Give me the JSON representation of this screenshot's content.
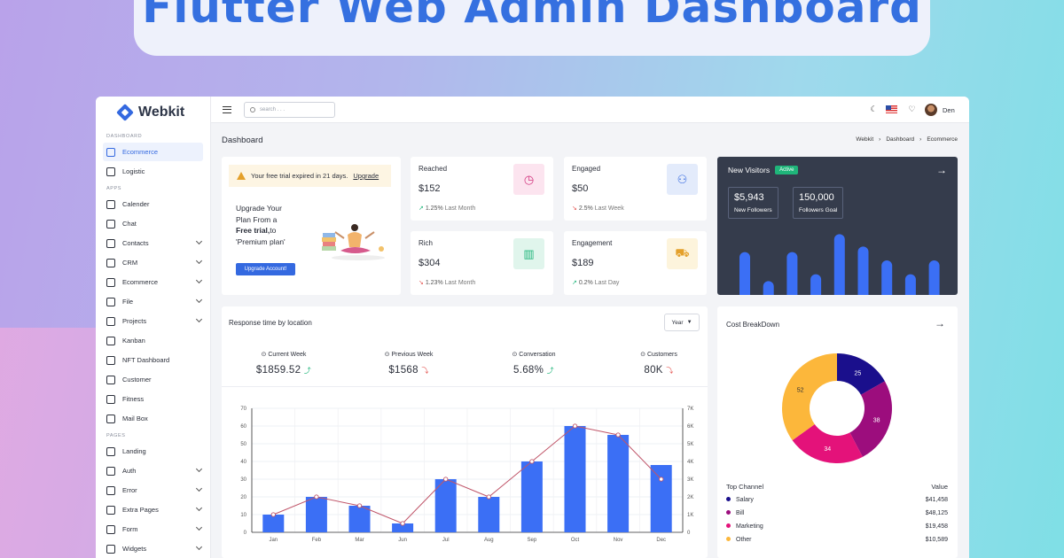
{
  "banner": {
    "title": "Flutter Web Admin Dashboard"
  },
  "brand": {
    "name": "Webkit"
  },
  "sidebar": {
    "sections": [
      {
        "label": "DASHBOARD",
        "items": [
          {
            "label": "Ecommerce",
            "active": true,
            "chevron": false
          },
          {
            "label": "Logistic",
            "chevron": false
          }
        ]
      },
      {
        "label": "APPS",
        "items": [
          {
            "label": "Calender",
            "chevron": false
          },
          {
            "label": "Chat",
            "chevron": false
          },
          {
            "label": "Contacts",
            "chevron": true
          },
          {
            "label": "CRM",
            "chevron": true
          },
          {
            "label": "Ecommerce",
            "chevron": true
          },
          {
            "label": "File",
            "chevron": true
          },
          {
            "label": "Projects",
            "chevron": true
          },
          {
            "label": "Kanban",
            "chevron": false
          },
          {
            "label": "NFT Dashboard",
            "chevron": false
          },
          {
            "label": "Customer",
            "chevron": false
          },
          {
            "label": "Fitness",
            "chevron": false
          },
          {
            "label": "Mail Box",
            "chevron": false
          }
        ]
      },
      {
        "label": "PAGES",
        "items": [
          {
            "label": "Landing",
            "chevron": false
          },
          {
            "label": "Auth",
            "chevron": true
          },
          {
            "label": "Error",
            "chevron": true
          },
          {
            "label": "Extra Pages",
            "chevron": true
          },
          {
            "label": "Form",
            "chevron": true
          },
          {
            "label": "Widgets",
            "chevron": true
          }
        ]
      }
    ]
  },
  "topbar": {
    "search_placeholder": "search . . .",
    "user_name": "Den",
    "icons": [
      "menu-icon",
      "moon-icon",
      "us-flag-icon",
      "bell-icon"
    ]
  },
  "page": {
    "title": "Dashboard",
    "breadcrumb": [
      "Webkit",
      "Dashboard",
      "Ecommerce"
    ]
  },
  "trial": {
    "message": "Your free trial expired in 21 days.",
    "link": "Upgrade",
    "line1": "Upgrade Your",
    "line2": "Plan From a",
    "line3_bold": "Free trial,",
    "line3_rest": "to",
    "line4": "'Premium plan'",
    "button": "Upgrade Account!"
  },
  "stats": [
    {
      "title": "Reached",
      "value": "$152",
      "change": "1.25%",
      "period": "Last Month",
      "trend": "up",
      "icon": "clock-icon",
      "bg": "#fce4ef",
      "fg": "#d3357f"
    },
    {
      "title": "Engaged",
      "value": "$50",
      "change": "2.5%",
      "period": "Last Week",
      "trend": "down",
      "icon": "network-icon",
      "bg": "#e3ebfb",
      "fg": "#3469e0"
    },
    {
      "title": "Rich",
      "value": "$304",
      "change": "1.23%",
      "period": "Last Month",
      "trend": "down",
      "icon": "chart-icon",
      "bg": "#e0f5ec",
      "fg": "#1fb57a"
    },
    {
      "title": "Engagement",
      "value": "$189",
      "change": "0.2%",
      "period": "Last Day",
      "trend": "up",
      "icon": "cart-icon",
      "bg": "#fdf4dc",
      "fg": "#e4a02a"
    }
  ],
  "visitors": {
    "title": "New Visitors",
    "badge": "Active",
    "followers": "$5,943",
    "followers_label": "New Followers",
    "goal": "150,000",
    "goal_label": "Followers Goal",
    "bars": [
      0.62,
      0.2,
      0.62,
      0.3,
      0.88,
      0.7,
      0.5,
      0.3,
      0.5
    ]
  },
  "response": {
    "title": "Response time by location",
    "dropdown": "Year",
    "kpis": [
      {
        "label": "Current Week",
        "value": "$1859.52",
        "trend": "up"
      },
      {
        "label": "Previous Week",
        "value": "$1568",
        "trend": "down"
      },
      {
        "label": "Conversation",
        "value": "5.68%",
        "trend": "up"
      },
      {
        "label": "Customers",
        "value": "80K",
        "trend": "down"
      }
    ]
  },
  "chart_data": {
    "type": "bar",
    "categories": [
      "Jan",
      "Feb",
      "Mar",
      "Jun",
      "Jul",
      "Aug",
      "Sep",
      "Oct",
      "Nov",
      "Dec"
    ],
    "series": [
      {
        "type": "bar",
        "values": [
          10,
          20,
          15,
          5,
          30,
          20,
          40,
          60,
          55,
          38
        ],
        "color": "#3b6ff5"
      },
      {
        "type": "line",
        "axis": "right",
        "values": [
          1000,
          2000,
          1500,
          500,
          3000,
          2000,
          4000,
          6000,
          5500,
          3000
        ],
        "color": "#c0566a"
      }
    ],
    "y_ticks": [
      "0",
      "10",
      "20",
      "30",
      "40",
      "50",
      "60",
      "70"
    ],
    "y2_ticks": [
      "0",
      "1K",
      "2K",
      "3K",
      "4K",
      "5K",
      "6K",
      "7K"
    ],
    "ylim": [
      0,
      70
    ],
    "y2lim": [
      0,
      7000
    ],
    "grid": true
  },
  "cost": {
    "title": "Cost BreakDown",
    "donut": {
      "type": "pie",
      "labels": [
        "25",
        "38",
        "34",
        "52"
      ],
      "values": [
        25,
        38,
        34,
        52
      ],
      "colors": [
        "#1a0f8c",
        "#9c0d7d",
        "#e4127a",
        "#fcb73b"
      ]
    },
    "table_header": [
      "Top Channel",
      "Value"
    ],
    "rows": [
      {
        "name": "Salary",
        "value": "$41,458",
        "color": "#1a0f8c"
      },
      {
        "name": "Bill",
        "value": "$48,125",
        "color": "#9c0d7d"
      },
      {
        "name": "Marketing",
        "value": "$19,458",
        "color": "#e4127a"
      },
      {
        "name": "Other",
        "value": "$10,589",
        "color": "#fcb73b"
      }
    ]
  }
}
